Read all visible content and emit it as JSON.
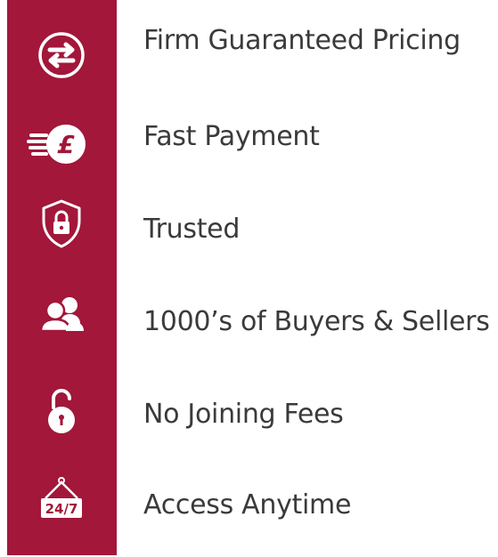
{
  "colors": {
    "icon_bar": "#a2173a",
    "icon": "#ffffff",
    "text": "#3a3a3a",
    "background": "#ffffff"
  },
  "features": [
    {
      "icon": "exchange-arrows-icon",
      "label": "Firm Guaranteed Pricing"
    },
    {
      "icon": "fast-pound-coin-icon",
      "label": "Fast Payment"
    },
    {
      "icon": "shield-lock-icon",
      "label": "Trusted"
    },
    {
      "icon": "people-group-icon",
      "label": "1000’s of Buyers & Sellers"
    },
    {
      "icon": "open-padlock-icon",
      "label": "No Joining Fees"
    },
    {
      "icon": "24-7-sign-icon",
      "label": "Access Anytime"
    }
  ],
  "sign_text": "24/7",
  "currency_symbol": "£"
}
